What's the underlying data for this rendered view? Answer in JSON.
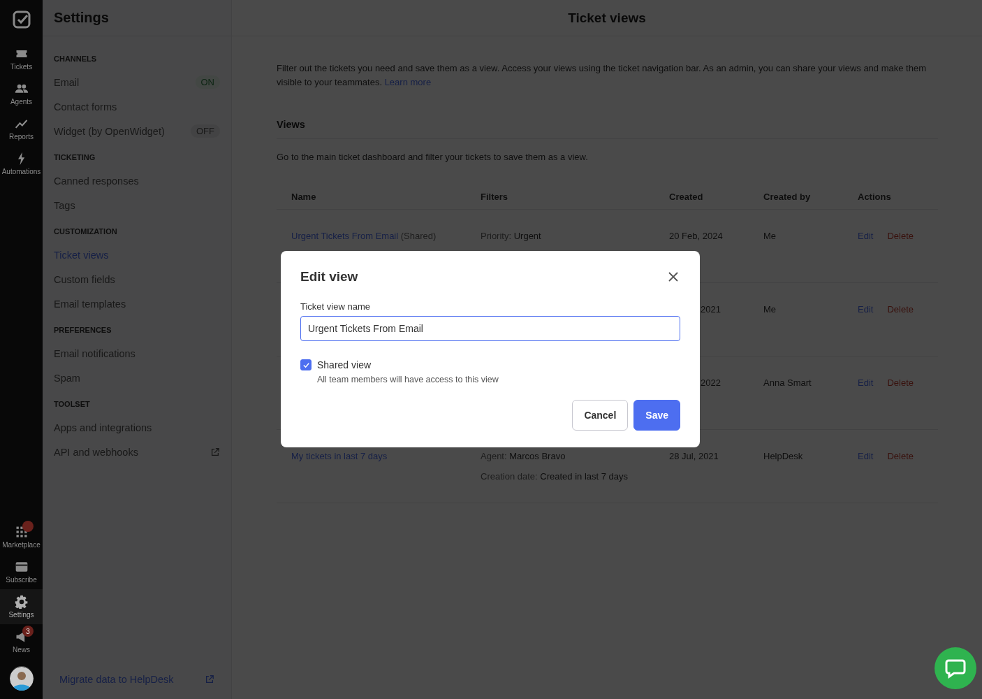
{
  "rail": {
    "top": [
      {
        "label": "Tickets",
        "kind": "ticket",
        "selected": false
      },
      {
        "label": "Agents",
        "kind": "people",
        "selected": false
      },
      {
        "label": "Reports",
        "kind": "chart",
        "selected": false
      },
      {
        "label": "Automations",
        "kind": "bolt",
        "selected": false
      }
    ],
    "bottom": [
      {
        "label": "Marketplace",
        "kind": "grid",
        "selected": false,
        "badge_dot": true
      },
      {
        "label": "Subscribe",
        "kind": "card",
        "selected": false
      },
      {
        "label": "Settings",
        "kind": "gear",
        "selected": true
      },
      {
        "label": "News",
        "kind": "megaphone",
        "selected": false,
        "badge": "3"
      }
    ]
  },
  "settings": {
    "title": "Settings",
    "sections": [
      {
        "heading": "CHANNELS",
        "items": [
          {
            "label": "Email",
            "selected": false,
            "status": {
              "text": "ON",
              "on": true
            }
          },
          {
            "label": "Contact forms",
            "selected": false
          },
          {
            "label": "Widget (by OpenWidget)",
            "selected": false,
            "status": {
              "text": "OFF",
              "on": false
            }
          }
        ]
      },
      {
        "heading": "TICKETING",
        "items": [
          {
            "label": "Canned responses",
            "selected": false
          },
          {
            "label": "Tags",
            "selected": false
          }
        ]
      },
      {
        "heading": "CUSTOMIZATION",
        "items": [
          {
            "label": "Ticket views",
            "selected": true
          },
          {
            "label": "Custom fields",
            "selected": false
          },
          {
            "label": "Email templates",
            "selected": false
          }
        ]
      },
      {
        "heading": "PREFERENCES",
        "items": [
          {
            "label": "Email notifications",
            "selected": false
          },
          {
            "label": "Spam",
            "selected": false
          }
        ]
      },
      {
        "heading": "TOOLSET",
        "items": [
          {
            "label": "Apps and integrations",
            "selected": false
          },
          {
            "label": "API and webhooks",
            "selected": false,
            "external": true
          }
        ]
      }
    ],
    "footer_link": "Migrate data to HelpDesk"
  },
  "main": {
    "title": "Ticket views",
    "intro": "Filter out the tickets you need and save them as a view. Access your views using the ticket navigation bar. As an admin, you can share your views and make them visible to your teammates.",
    "learn_more": "Learn more",
    "views_heading": "Views",
    "views_text": "Go to the main ticket dashboard and filter your tickets to save them as a view.",
    "table": {
      "columns": [
        "Name",
        "Filters",
        "Created",
        "Created by",
        "Actions"
      ],
      "rows": [
        {
          "name": "Urgent Tickets From Email",
          "suffix": "(Shared)",
          "filters": [
            {
              "label": "Priority:",
              "value": "Urgent"
            }
          ],
          "created": "20 Feb, 2024",
          "created_cut": false,
          "created_by": "Me",
          "edit": "Edit",
          "delete": "Delete"
        },
        {
          "created": "2021",
          "created_cut": true,
          "created_by": "Me",
          "edit": "Edit",
          "delete": "Delete"
        },
        {
          "created": "2022",
          "created_cut": true,
          "created_by": "Anna Smart",
          "edit": "Edit",
          "delete": "Delete"
        },
        {
          "name": "My tickets in last 7 days",
          "filters": [
            {
              "label": "Agent:",
              "value": "Marcos Bravo"
            },
            {
              "label": "Creation date:",
              "value": "Created in last 7 days"
            }
          ],
          "created": "28 Jul, 2021",
          "created_cut": false,
          "created_by": "HelpDesk",
          "edit": "Edit",
          "delete": "Delete"
        }
      ]
    }
  },
  "dialog": {
    "title": "Edit view",
    "field_label": "Ticket view name",
    "field_value": "Urgent Tickets From Email",
    "checkbox": {
      "label": "Shared view",
      "checked": true,
      "help": "All team members will have access to this view"
    },
    "cancel": "Cancel",
    "save": "Save"
  }
}
